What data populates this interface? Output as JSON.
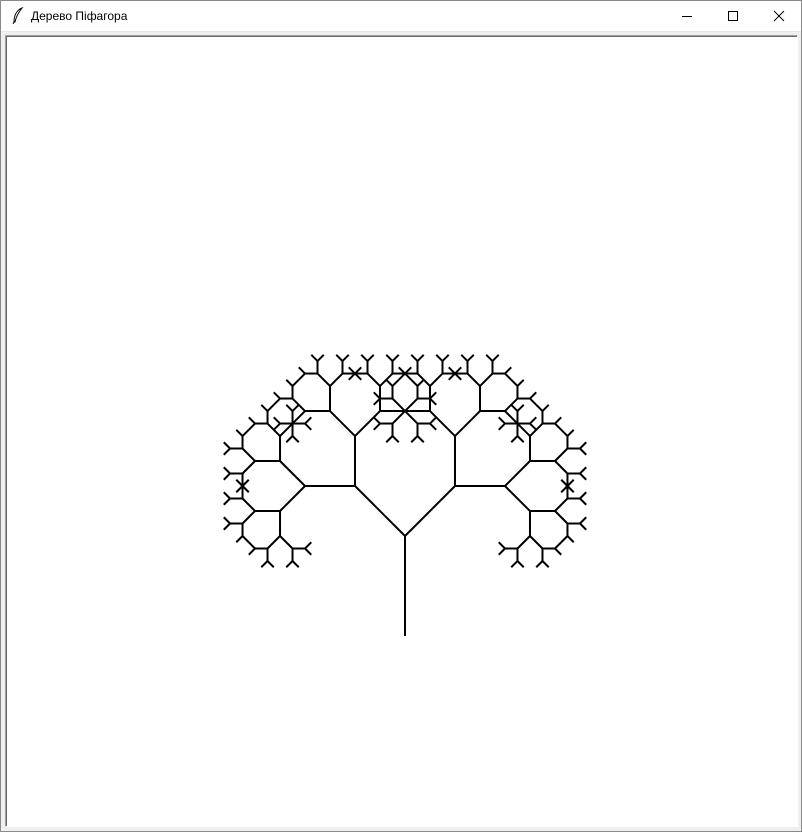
{
  "window": {
    "title": "Дерево Піфагора",
    "icon": "feather-icon"
  },
  "controls": {
    "minimize_icon": "minimize-icon",
    "maximize_icon": "maximize-icon",
    "close_icon": "close-icon"
  },
  "canvas": {
    "background": "#ffffff",
    "stroke_color": "#000000",
    "tree": {
      "type": "pythagoras-tree",
      "depth": 7,
      "branch_angle_deg": 45
    }
  }
}
